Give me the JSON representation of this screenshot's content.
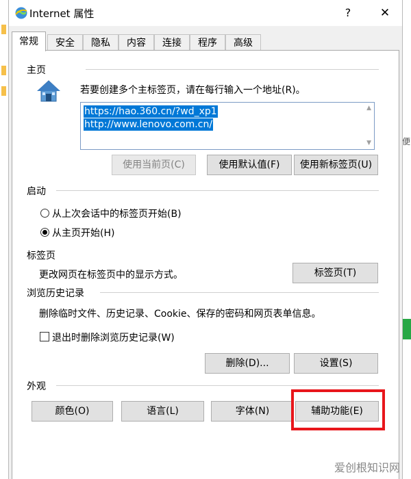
{
  "window": {
    "title": "Internet 属性",
    "help_glyph": "?",
    "close_glyph": "✕"
  },
  "tabs": [
    {
      "label": "常规",
      "active": true
    },
    {
      "label": "安全"
    },
    {
      "label": "隐私"
    },
    {
      "label": "内容"
    },
    {
      "label": "连接"
    },
    {
      "label": "程序"
    },
    {
      "label": "高级"
    }
  ],
  "homepage": {
    "group_label": "主页",
    "instruction": "若要创建多个主标签页，请在每行输入一个地址(R)。",
    "urls": [
      "https://hao.360.cn/?wd_xp1",
      "http://www.lenovo.com.cn/"
    ],
    "buttons": {
      "use_current": "使用当前页(C)",
      "use_default": "使用默认值(F)",
      "use_new_tab": "使用新标签页(U)"
    }
  },
  "startup": {
    "group_label": "启动",
    "option_last_session": "从上次会话中的标签页开始(B)",
    "option_homepage": "从主页开始(H)",
    "selected": "homepage"
  },
  "tabs_section": {
    "group_label": "标签页",
    "description": "更改网页在标签页中的显示方式。",
    "button": "标签页(T)"
  },
  "history": {
    "group_label": "浏览历史记录",
    "description": "删除临时文件、历史记录、Cookie、保存的密码和网页表单信息。",
    "checkbox_label": "退出时删除浏览历史记录(W)",
    "checkbox_checked": false,
    "delete_button": "删除(D)...",
    "settings_button": "设置(S)"
  },
  "appearance": {
    "group_label": "外观",
    "buttons": {
      "colors": "颜色(O)",
      "languages": "语言(L)",
      "fonts": "字体(N)",
      "accessibility": "辅助功能(E)"
    }
  },
  "background": {
    "right_glyph": "便"
  },
  "watermark": "爱创根知识网",
  "colors": {
    "highlight": "#e8161b",
    "selection": "#0078d7",
    "accent_bar": "#27a745"
  }
}
